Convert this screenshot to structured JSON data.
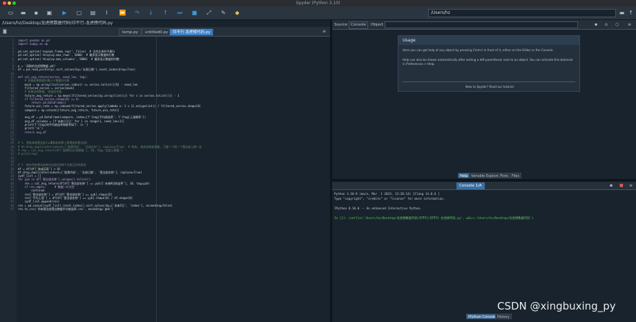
{
  "window": {
    "title": "Spyder (Python 3.10)"
  },
  "toolbar": {
    "path": "/Users/hz",
    "icons": [
      "new-file-icon",
      "open-file-icon",
      "save-icon",
      "save-all-icon",
      "run-icon",
      "run-cell-icon",
      "run-cell-advance-icon",
      "run-selection-icon",
      "debug-icon",
      "step-icon",
      "step-into-icon",
      "step-return-icon",
      "continue-icon",
      "stop-icon",
      "maximize-icon",
      "preferences-icon",
      "python-path-icon"
    ]
  },
  "editor": {
    "breadcrumb": "/Users/hz/Desktop/龙虎榜数据代码(印不行-龙虎榜代码.py",
    "tabs": [
      {
        "label": "temp.py"
      },
      {
        "label": "untitled0.py"
      },
      {
        "label": "印不行-龙虎榜代码.py"
      }
    ],
    "lines": [
      "import pandas as pd",
      "import numpy as np",
      "",
      "pd.set_option('expand_frame_repr', False)  # 当列太多时不换行",
      "pd.set_option('display.max_rows', 5000)  # 最多显示数据的行数",
      "pd.set_option('display.max_columns', 5000)  # 最多显示数据的列数",
      "",
      "p = '读取的龙虎榜数据.pkl'",
      "df = pd.read_pickle(p).sort_values(by='交易日期').reset_index(drop=True)",
      "",
      "def cal_avg_return(series, need_len, tag):",
      "    # 如果股票数据行数小于需要的天数",
      "    mask = np.array(list(series.index)) >= series.tolist()[0] - need_len",
      "    filtered_series = series[mask]",
      "    # 如果没有数据, 则返回空值",
      "    future_avg_return = np.mean([filtered_series[np.array(list(s)) for s in series.tolist()]) - 1",
      "    if filtered_series.shape[0] == 0:",
      "        return pd.DataFrame()",
      "    future_win_rate = np.cumsum(filtered_series.apply(lambda x: 1 > 1).astype(int)) / filtered_series.shape[0]",
      "    compare = np.vstack([future_avg_return, future_win_rate])",
      "",
      "    avg_df = pd.DataFrame(compare, index=[f'{tag}平均收益率', f'{tag}上涨概率'])",
      "    avg_df.columns = [f'未来{i}日' for i in range(1, need_len+1)]",
      "    print(f'{tag}的平均收益率和胜率如下: \\n ')",
      "    print('\\n')",
      "    return avg_df",
      "",
      "",
      "# 1. 筛选有效营业部(从事和机构等上榜理由的营业部)",
      "# df.drop_duplicates(subset=['股票代码', '买卖方向'], inplace=True)  # 机构, 其实机构很多重, 只要一个同一个营业部上榜一次",
      "# rep = cal_avg_return(df['股票N日后涨跌幅'], 10, tag='全部上榜股')",
      "# print(rep)",
      "",
      "",
      "# 2. 统计所有营业部单次出现后的N个交易日后的表现",
      "df = df[df['卖或买家'] > 0]",
      "df.drop_duplicates(subset=['股票代码', '交易日期', '营业部名称'], inplace=True)",
      "sydf_list = []",
      "for yyb in df['营业部名称'].unique().tolist():",
      "    res = cal_avg_return(df[df['营业部名称'] == yyb]['未来N日收益率'], 10, tag=yyb)",
      "    if res.empty:     # 数据一行为空",
      "        continue",
      "    res['营业部名称'] = df[df['营业部名称'] == yyb].shape[0]",
      "    res['平均上涨'] = df[df['营业部名称'] == yyb].shape[0] / df.shape[0]",
      "    sydf_list.append(res)",
      "res = pd.concat(sydf_list).reset_index().sort_values(by=['未来5日', 'index'], ascending=False)",
      "res.to_csv('所有营业部营业数据平均收益率.csv', encoding='gbk')"
    ]
  },
  "help_pane": {
    "source_label": "Source",
    "console_option": "Console",
    "object_label": "Object",
    "usage_title": "Usage",
    "usage_p1": "Here you can get help of any object by pressing Cmd+I in front of it, either on the Editor or the Console.",
    "usage_p2": "Help can also be shown automatically after writing a left parenthesis next to an object. You can activate this behavior in Preferences > Help.",
    "usage_p3": "New to Spyder? Read our tutorial",
    "tabs": [
      {
        "label": "Help"
      },
      {
        "label": "Variable Explorer"
      },
      {
        "label": "Plots"
      },
      {
        "label": "Files"
      }
    ]
  },
  "console_pane": {
    "tab_label": "Console 1/A",
    "lines": [
      "Python 3.10.9 (main, Mar  1 2023, 12:20:14) [Clang 14.0.6 ]",
      "Type \"copyright\", \"credits\" or \"license\" for more information.",
      "",
      "IPython 8.10.0 -- An enhanced Interactive Python.",
      "",
      "In [1]: runfile('/Users/hz/Desktop/龙虎榜数据代码(印不行/印不行-龙虎榜代码.py', wdir='/Users/hz/Desktop/龙虎榜数据代码')"
    ],
    "tabs": [
      {
        "label": "IPython Console"
      },
      {
        "label": "History"
      }
    ]
  },
  "watermark": "CSDN @xingbuxing_py",
  "colors": {
    "background": "#19232d",
    "accent": "#3b97d8",
    "active_tab": "#3b7fc4"
  }
}
